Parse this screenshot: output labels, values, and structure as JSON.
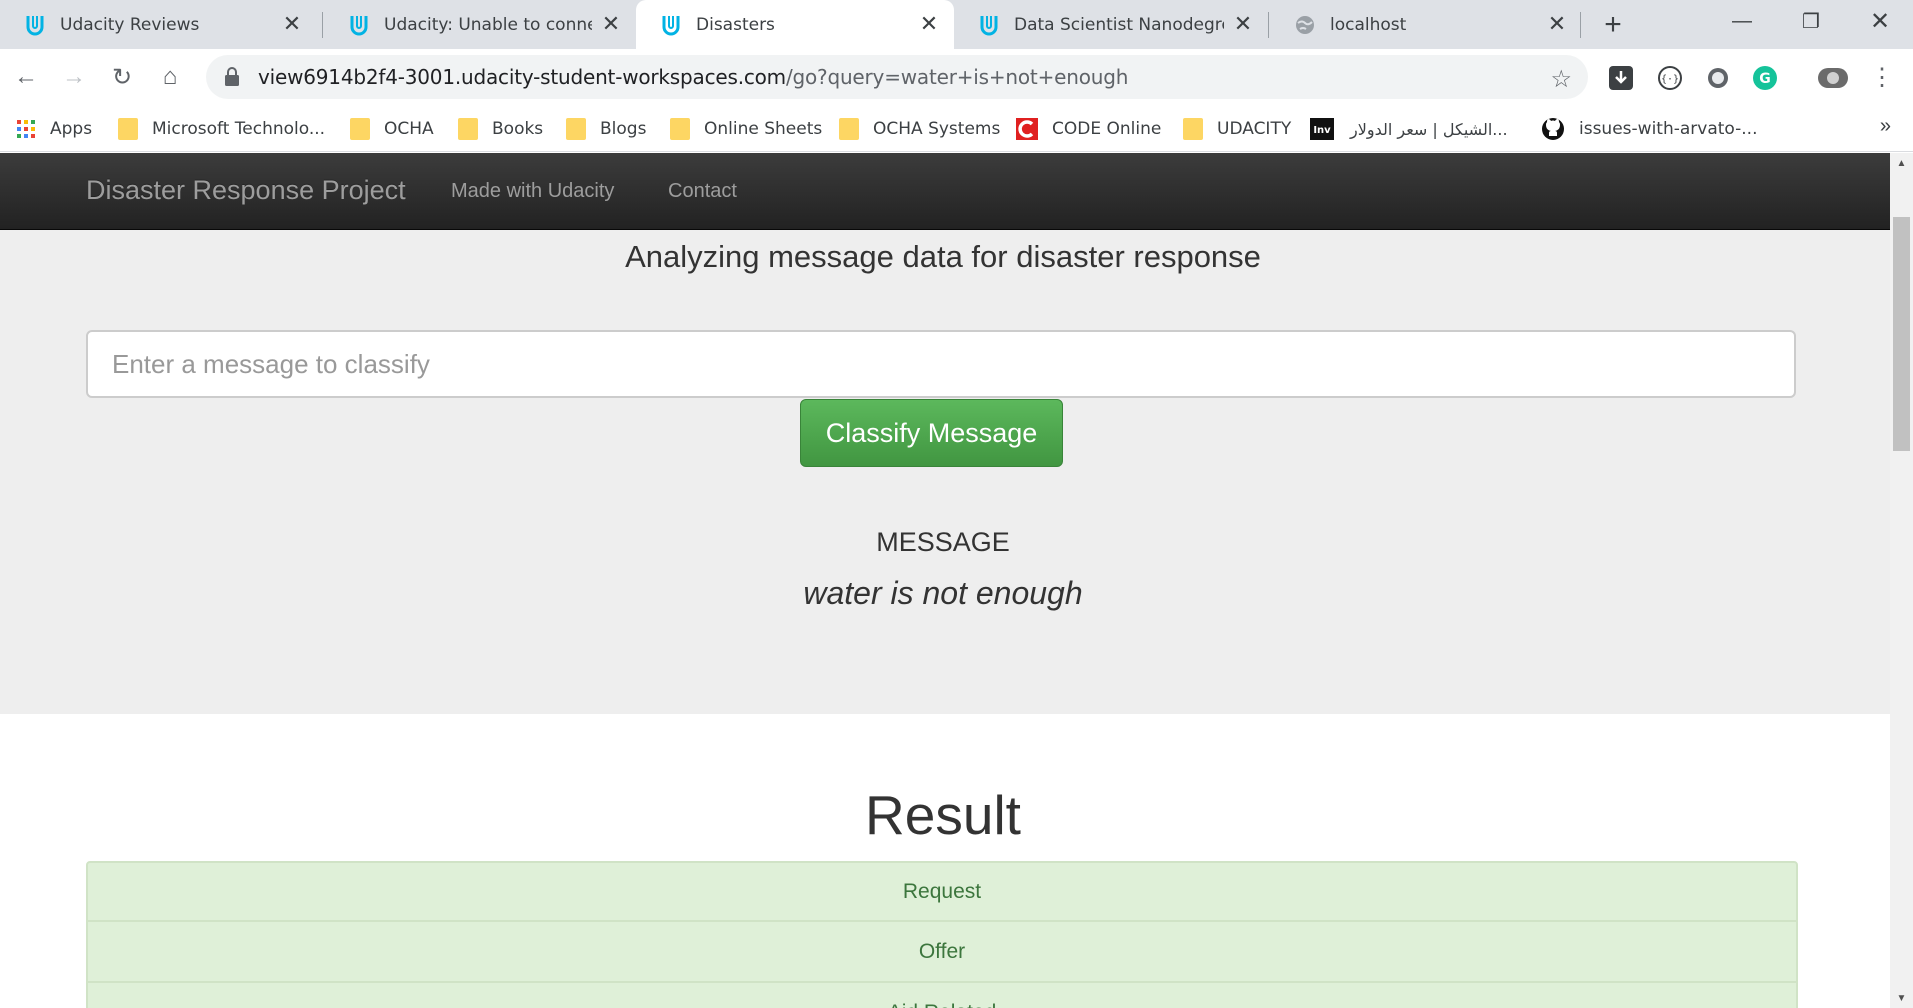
{
  "browser": {
    "tabs": [
      {
        "title": "Udacity Reviews",
        "icon": "udacity-icon",
        "active": false
      },
      {
        "title": "Udacity: Unable to connect",
        "icon": "udacity-icon",
        "active": false
      },
      {
        "title": "Disasters",
        "icon": "udacity-icon",
        "active": true
      },
      {
        "title": "Data Scientist Nanodegree",
        "icon": "udacity-icon",
        "active": false
      },
      {
        "title": "localhost",
        "icon": "globe-icon",
        "active": false
      }
    ],
    "url_host": "view6914b2f4-3001.udacity-student-workspaces.com",
    "url_path": "/go?query=water+is+not+enough",
    "bookmarks": [
      {
        "label": "Apps",
        "icon": "apps-grid-icon"
      },
      {
        "label": "Microsoft Technolo...",
        "icon": "folder-icon"
      },
      {
        "label": "OCHA",
        "icon": "folder-icon"
      },
      {
        "label": "Books",
        "icon": "folder-icon"
      },
      {
        "label": "Blogs",
        "icon": "folder-icon"
      },
      {
        "label": "Online Sheets",
        "icon": "folder-icon"
      },
      {
        "label": "OCHA Systems",
        "icon": "folder-icon"
      },
      {
        "label": "CODE Online",
        "icon": "code-online-icon"
      },
      {
        "label": "UDACITY",
        "icon": "folder-icon"
      },
      {
        "label": "الشيكل | سعر الدولار...",
        "icon": "inv-icon"
      },
      {
        "label": "issues-with-arvato-...",
        "icon": "github-icon"
      }
    ],
    "bookmarks_more": "»"
  },
  "page": {
    "brand": "Disaster Response Project",
    "nav_links": [
      "Made with Udacity",
      "Contact"
    ],
    "subtitle": "Analyzing message data for disaster response",
    "input_placeholder": "Enter a message to classify",
    "classify_button": "Classify Message",
    "message_label": "MESSAGE",
    "message_text": "water is not enough",
    "result_heading": "Result",
    "result_categories": [
      "Request",
      "Offer",
      "Aid Related"
    ]
  },
  "colors": {
    "navbar": "#222222",
    "success_bg": "#dff0d8",
    "success_text": "#3c763d",
    "button_green": "#5cb85c",
    "udacity_blue": "#02b3e4"
  }
}
